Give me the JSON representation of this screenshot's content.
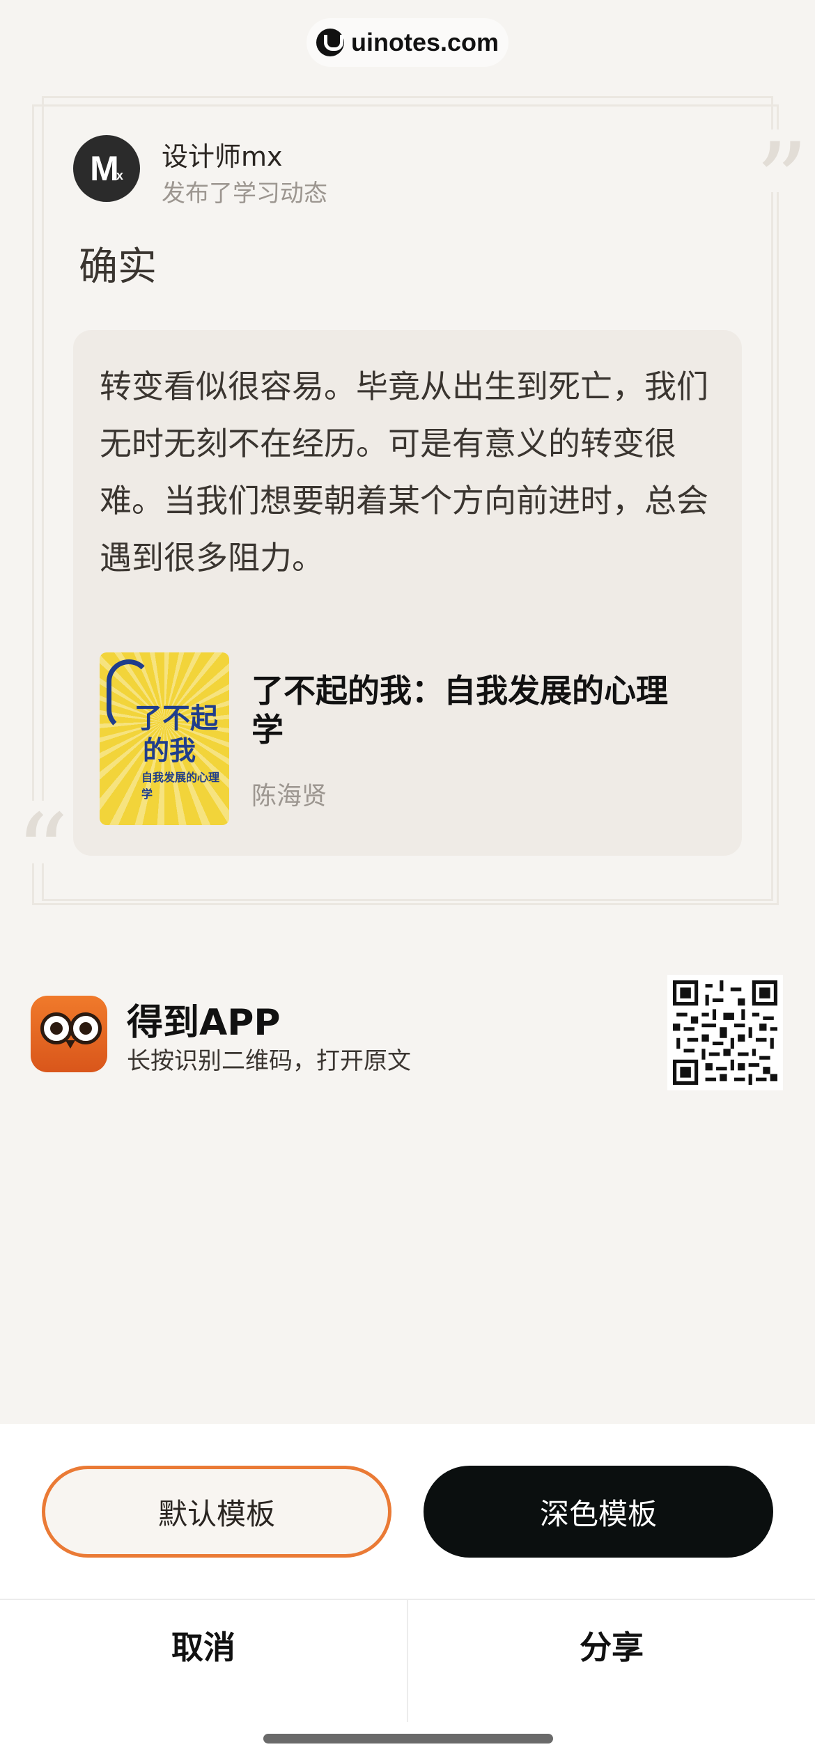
{
  "watermark": {
    "text": "uinotes.com"
  },
  "post": {
    "user_name": "设计师mx",
    "action": "发布了学习动态",
    "avatar_text": "M",
    "text": "确实"
  },
  "quote": {
    "text": "转变看似很容易。毕竟从出生到死亡，我们无时无刻不在经历。可是有意义的转变很难。当我们想要朝着某个方向前进时，总会遇到很多阻力。",
    "book_title": "了不起的我：自我发展的心理学",
    "author": "陈海贤",
    "cover_line1": "了不起",
    "cover_line2": "的我",
    "cover_sub": "自我发展的心理学"
  },
  "app": {
    "name": "得到APP",
    "subtitle": "长按识别二维码，打开原文"
  },
  "templates": {
    "default_label": "默认模板",
    "dark_label": "深色模板"
  },
  "actions": {
    "cancel": "取消",
    "share": "分享"
  },
  "colors": {
    "accent_orange": "#ea7a35",
    "dark_button": "#0b0f0f",
    "background": "#f6f4f1",
    "quote_box": "#efebe6"
  }
}
